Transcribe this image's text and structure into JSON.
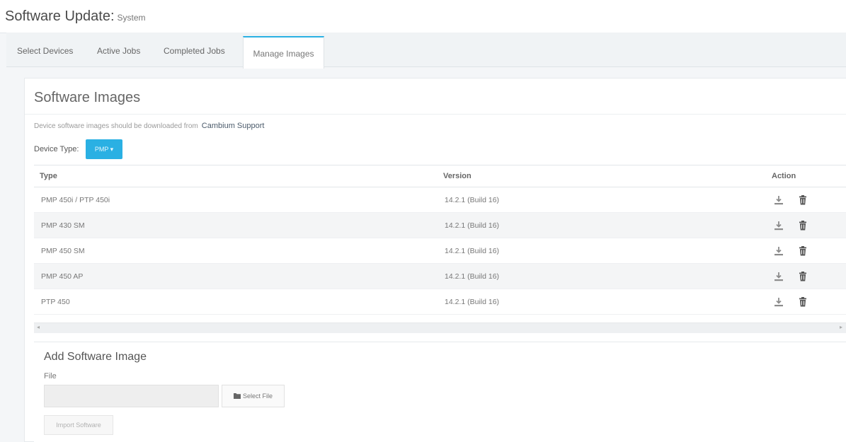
{
  "header": {
    "title": "Software Update:",
    "subtitle": "System"
  },
  "tabs": [
    {
      "label": "Select Devices",
      "active": false
    },
    {
      "label": "Active Jobs",
      "active": false
    },
    {
      "label": "Completed Jobs",
      "active": false
    },
    {
      "label": "Manage Images",
      "active": true
    }
  ],
  "images_panel": {
    "title": "Software Images",
    "download_note": "Device software images should be downloaded from",
    "download_link": "Cambium Support",
    "device_type_label": "Device Type:",
    "device_type_value": "PMP ▾",
    "table": {
      "headers": {
        "type": "Type",
        "version": "Version",
        "action": "Action"
      },
      "rows": [
        {
          "type": "PMP 450i / PTP 450i",
          "version": "14.2.1 (Build 16)"
        },
        {
          "type": "PMP 430 SM",
          "version": "14.2.1 (Build 16)"
        },
        {
          "type": "PMP 450 SM",
          "version": "14.2.1 (Build 16)"
        },
        {
          "type": "PMP 450 AP",
          "version": "14.2.1 (Build 16)"
        },
        {
          "type": "PTP 450",
          "version": "14.2.1 (Build 16)"
        }
      ],
      "action_icons": [
        "download-icon",
        "trash-icon"
      ]
    }
  },
  "add_image": {
    "title": "Add Software Image",
    "file_label": "File",
    "file_value": "",
    "select_file_label": "Select File",
    "import_label": "Import Software"
  },
  "colors": {
    "accent": "#2ab0e3",
    "background": "#f4f6f8"
  }
}
